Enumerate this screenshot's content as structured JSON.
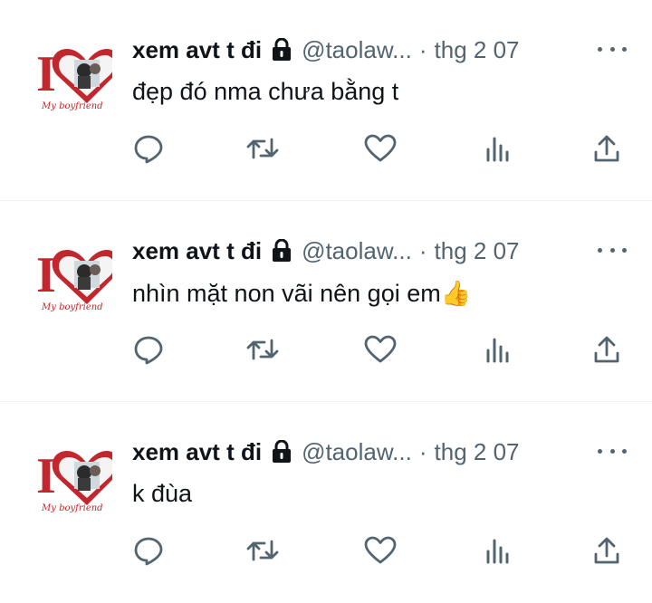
{
  "tweets": [
    {
      "name": "xem avt t đi",
      "handle": "@taolaw...",
      "separator": "·",
      "time": "thg 2 07",
      "text": "đẹp đó nma chưa bằng t"
    },
    {
      "name": "xem avt t đi",
      "handle": "@taolaw...",
      "separator": "·",
      "time": "thg 2 07",
      "text": "nhìn mặt non vãi nên gọi em👍"
    },
    {
      "name": "xem avt t đi",
      "handle": "@taolaw...",
      "separator": "·",
      "time": "thg 2 07",
      "text": "k đùa"
    }
  ],
  "avatar": {
    "big_letter": "I",
    "caption": "My boyfriend",
    "heart_color": "#c1272d"
  },
  "icons": {
    "protected": "lock-icon",
    "more": "more-horizontal-icon",
    "reply": "reply-icon",
    "retweet": "retweet-icon",
    "like": "heart-icon",
    "views": "views-icon",
    "share": "share-icon"
  },
  "colors": {
    "text": "#0f1419",
    "secondary": "#536471",
    "divider": "#eff3f4"
  }
}
